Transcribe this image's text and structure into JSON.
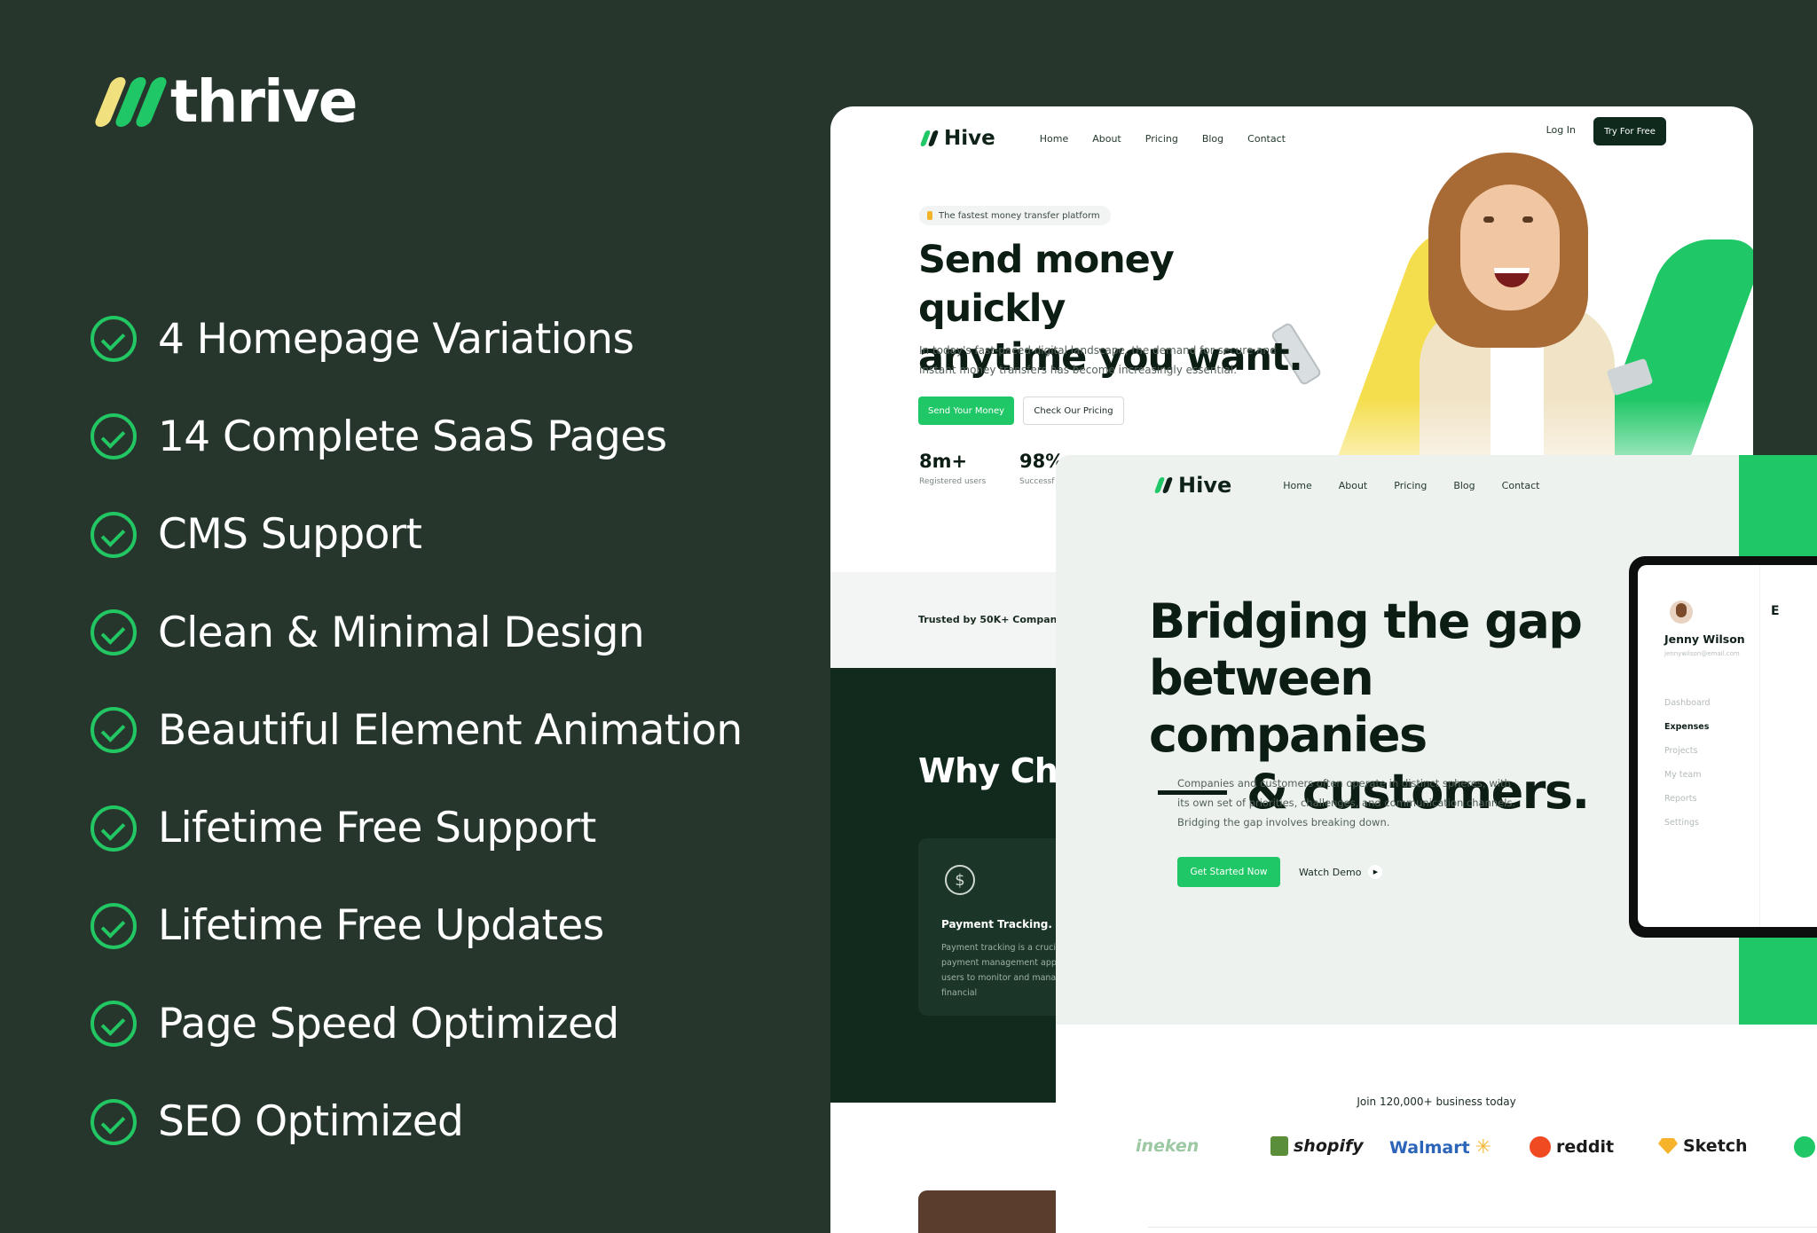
{
  "brand": {
    "name": "thrive"
  },
  "features": [
    "4 Homepage Variations",
    "14 Complete SaaS Pages",
    "CMS Support",
    "Clean & Minimal Design",
    "Beautiful Element Animation",
    "Lifetime Free Support",
    "Lifetime Free Updates",
    "Page Speed Optimized",
    "SEO Optimized"
  ],
  "mockup1": {
    "logo": "Hive",
    "nav": [
      "Home",
      "About",
      "Pricing",
      "Blog",
      "Contact"
    ],
    "login": "Log In",
    "try_button": "Try For Free",
    "badge": "The fastest money transfer platform",
    "headline_line1": "Send money quickly",
    "headline_line2": "anytime you want.",
    "description": "In today's fast-paced digital landscape, the demand for secure and instant money transfers has become increasingly essential.",
    "cta_primary": "Send Your Money",
    "cta_secondary": "Check Our Pricing",
    "stats": [
      {
        "value": "8m+",
        "label": "Registered users"
      },
      {
        "value": "98%",
        "label": "Successf"
      }
    ],
    "trusted": "Trusted by 50K+ Compani",
    "why_heading": "Why Cho",
    "payment_card": {
      "icon": "dollar-icon",
      "title": "Payment Tracking.",
      "text": "Payment tracking is a crucial payment management app t users to monitor and manag financial"
    }
  },
  "mockup2": {
    "logo": "Hive",
    "nav": [
      "Home",
      "About",
      "Pricing",
      "Blog",
      "Contact"
    ],
    "headline_line1": "Bridging the gap",
    "headline_line2": "between companies",
    "headline_line3": "& customers.",
    "description": "Companies and customers often operate in distinct spheres, with its own set of priorities, challenges, and communication channels. Bridging the gap involves breaking down.",
    "cta_primary": "Get Started Now",
    "cta_secondary": "Watch Demo",
    "dashboard": {
      "user_name": "Jenny Wilson",
      "user_email": "jennywilson@email.com",
      "menu": [
        "Dashboard",
        "Expenses",
        "Projects",
        "My team",
        "Reports",
        "Settings"
      ],
      "active_menu": "Expenses",
      "right_initial": "E"
    },
    "join_text": "Join 120,000+ business today",
    "logos": [
      "ineken",
      "shopify",
      "Walmart",
      "reddit",
      "Sketch"
    ]
  },
  "colors": {
    "background": "#26362c",
    "accent_green": "#1fc766",
    "accent_yellow": "#f1e17e",
    "dark_green": "#122a1e"
  }
}
